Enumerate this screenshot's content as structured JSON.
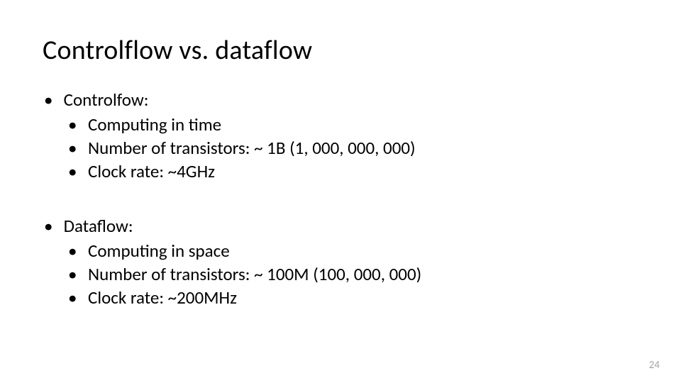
{
  "title": "Controlflow vs. dataflow",
  "sections": [
    {
      "heading": "Controlfow:",
      "items": [
        "Computing in time",
        "Number of transistors: ~ 1B (1, 000, 000, 000)",
        "Clock rate: ~4GHz"
      ]
    },
    {
      "heading": "Dataflow:",
      "items": [
        "Computing in space",
        "Number of transistors: ~ 100M (100, 000, 000)",
        "Clock rate: ~200MHz"
      ]
    }
  ],
  "page_number": "24"
}
